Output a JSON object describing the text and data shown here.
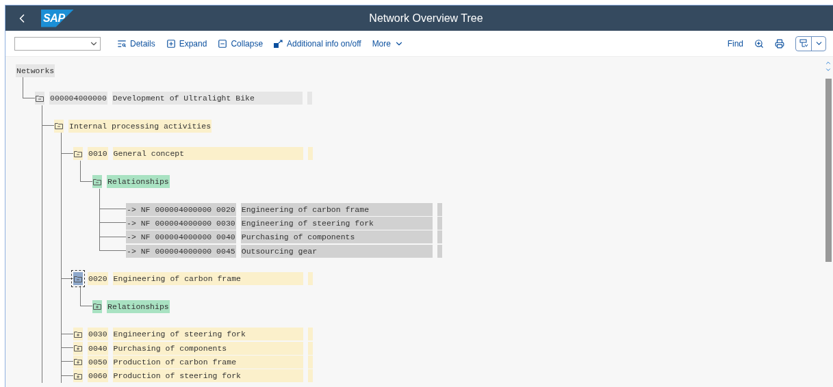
{
  "header": {
    "logo": "SAP",
    "title": "Network Overview Tree"
  },
  "toolbar": {
    "actions": [
      {
        "kind": "details",
        "label": "Details"
      },
      {
        "kind": "expand",
        "label": "Expand"
      },
      {
        "kind": "collapse",
        "label": "Collapse"
      },
      {
        "kind": "info",
        "label": "Additional info on/off"
      },
      {
        "kind": "more",
        "label": "More"
      }
    ],
    "find": "Find"
  },
  "tree": {
    "root": "Networks",
    "children": [
      {
        "kind": "folder",
        "expanded": true,
        "selected": false,
        "color": "#e6e6e6",
        "code": "000004000000",
        "text": "Development of Ultralight Bike",
        "more_below": true,
        "children": [
          {
            "kind": "folder",
            "expanded": true,
            "selected": false,
            "color": "#fbf0cb",
            "text": "Internal processing activities",
            "more_below": true,
            "children": [
              {
                "kind": "folder",
                "expanded": true,
                "selected": false,
                "color": "#fbf0cb",
                "code": "0010",
                "text": "General concept",
                "children": [
                  {
                    "kind": "folder",
                    "expanded": true,
                    "selected": false,
                    "color": "#a9e2c2",
                    "text": "Relationships",
                    "children": [
                      {
                        "kind": "link",
                        "color": "#d1d1d1",
                        "code": "-> NF 000004000000 0020",
                        "text": "Engineering of carbon frame"
                      },
                      {
                        "kind": "link",
                        "color": "#d1d1d1",
                        "code": "-> NF 000004000000 0030",
                        "text": "Engineering of steering fork"
                      },
                      {
                        "kind": "link",
                        "color": "#d1d1d1",
                        "code": "-> NF 000004000000 0040",
                        "text": "Purchasing of components"
                      },
                      {
                        "kind": "link",
                        "color": "#d1d1d1",
                        "code": "-> NF 000004000000 0045",
                        "text": "Outsourcing gear"
                      }
                    ]
                  }
                ]
              },
              {
                "kind": "folder",
                "expanded": true,
                "selected": true,
                "color": "#fbf0cb",
                "code": "0020",
                "text": "Engineering of carbon frame",
                "children": [
                  {
                    "kind": "folder",
                    "expanded": false,
                    "selected": false,
                    "color": "#a9e2c2",
                    "text": "Relationships"
                  }
                ]
              },
              {
                "kind": "folder",
                "expanded": false,
                "selected": false,
                "color": "#fbf0cb",
                "code": "0030",
                "text": "Engineering of steering fork"
              },
              {
                "kind": "folder",
                "expanded": false,
                "selected": false,
                "color": "#fbf0cb",
                "code": "0040",
                "text": "Purchasing of components"
              },
              {
                "kind": "folder",
                "expanded": false,
                "selected": false,
                "color": "#fbf0cb",
                "code": "0050",
                "text": "Production of carbon frame"
              },
              {
                "kind": "folder",
                "expanded": false,
                "selected": false,
                "color": "#fbf0cb",
                "code": "0060",
                "text": "Production of steering fork"
              }
            ]
          }
        ]
      }
    ]
  }
}
